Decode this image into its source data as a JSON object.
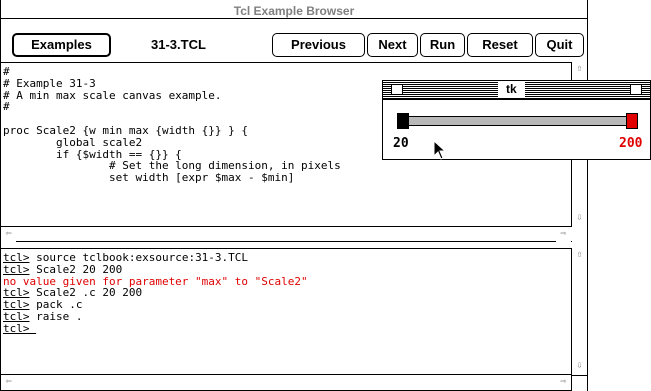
{
  "window": {
    "title": "Tcl Example Browser"
  },
  "toolbar": {
    "examples_label": "Examples",
    "filename": "31-3.TCL",
    "previous_label": "Previous",
    "next_label": "Next",
    "run_label": "Run",
    "reset_label": "Reset",
    "quit_label": "Quit"
  },
  "source": {
    "text": "#\n# Example 31-3\n# A min max scale canvas example.\n#\n\nproc Scale2 {w min max {width {}} } {\n        global scale2\n        if {$width == {}} {\n                # Set the long dimension, in pixels\n                set width [expr $max - $min]"
  },
  "console": {
    "lines": [
      {
        "prompt": "tcl>",
        "text": " source tclbook:exsource:31-3.TCL"
      },
      {
        "prompt": "tcl>",
        "text": " Scale2 20 200"
      },
      {
        "error": "no value given for parameter \"max\" to \"Scale2\""
      },
      {
        "prompt": "tcl>",
        "text": " Scale2 .c 20 200"
      },
      {
        "prompt": "tcl>",
        "text": " pack .c"
      },
      {
        "prompt": "tcl>",
        "text": " raise ."
      },
      {
        "prompt": "tcl>",
        "text": " "
      }
    ]
  },
  "tk_window": {
    "title": "tk",
    "min_label": "20",
    "max_label": "200",
    "min_value": 20,
    "max_value": 200,
    "colors": {
      "max_knob": "#e00000",
      "min_knob": "#000000",
      "max_text": "#e00000"
    }
  },
  "colors": {
    "error_text": "#e00000"
  }
}
